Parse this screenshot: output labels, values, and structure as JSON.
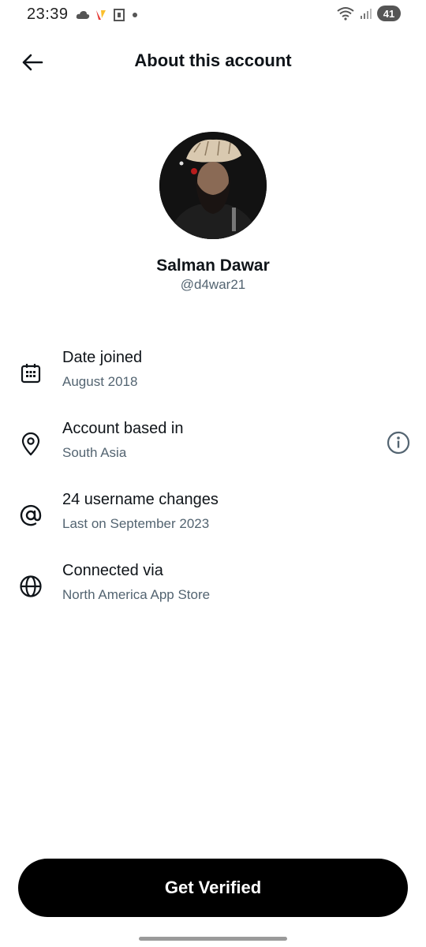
{
  "status_bar": {
    "time": "23:39",
    "battery_level": "41",
    "icons_left": [
      "cloud-icon",
      "notification-app-icon",
      "sim-icon",
      "dot-icon"
    ],
    "icons_right": [
      "wifi-icon",
      "signal-icon",
      "battery-icon"
    ]
  },
  "header": {
    "title": "About this account"
  },
  "profile": {
    "display_name": "Salman Dawar",
    "handle": "@d4war21"
  },
  "info_rows": [
    {
      "icon": "calendar-icon",
      "title": "Date joined",
      "subtitle": "August 2018"
    },
    {
      "icon": "location-pin-icon",
      "title": "Account based in",
      "subtitle": "South Asia",
      "trailing_icon": "info-icon"
    },
    {
      "icon": "at-sign-icon",
      "title": "24 username changes",
      "subtitle": "Last on September 2023"
    },
    {
      "icon": "globe-icon",
      "title": "Connected via",
      "subtitle": "North America App Store"
    }
  ],
  "footer": {
    "button_label": "Get Verified"
  },
  "colors": {
    "primary_text": "#0f1419",
    "secondary_text": "#536471",
    "button_bg": "#000000",
    "button_text": "#ffffff",
    "background": "#ffffff"
  }
}
